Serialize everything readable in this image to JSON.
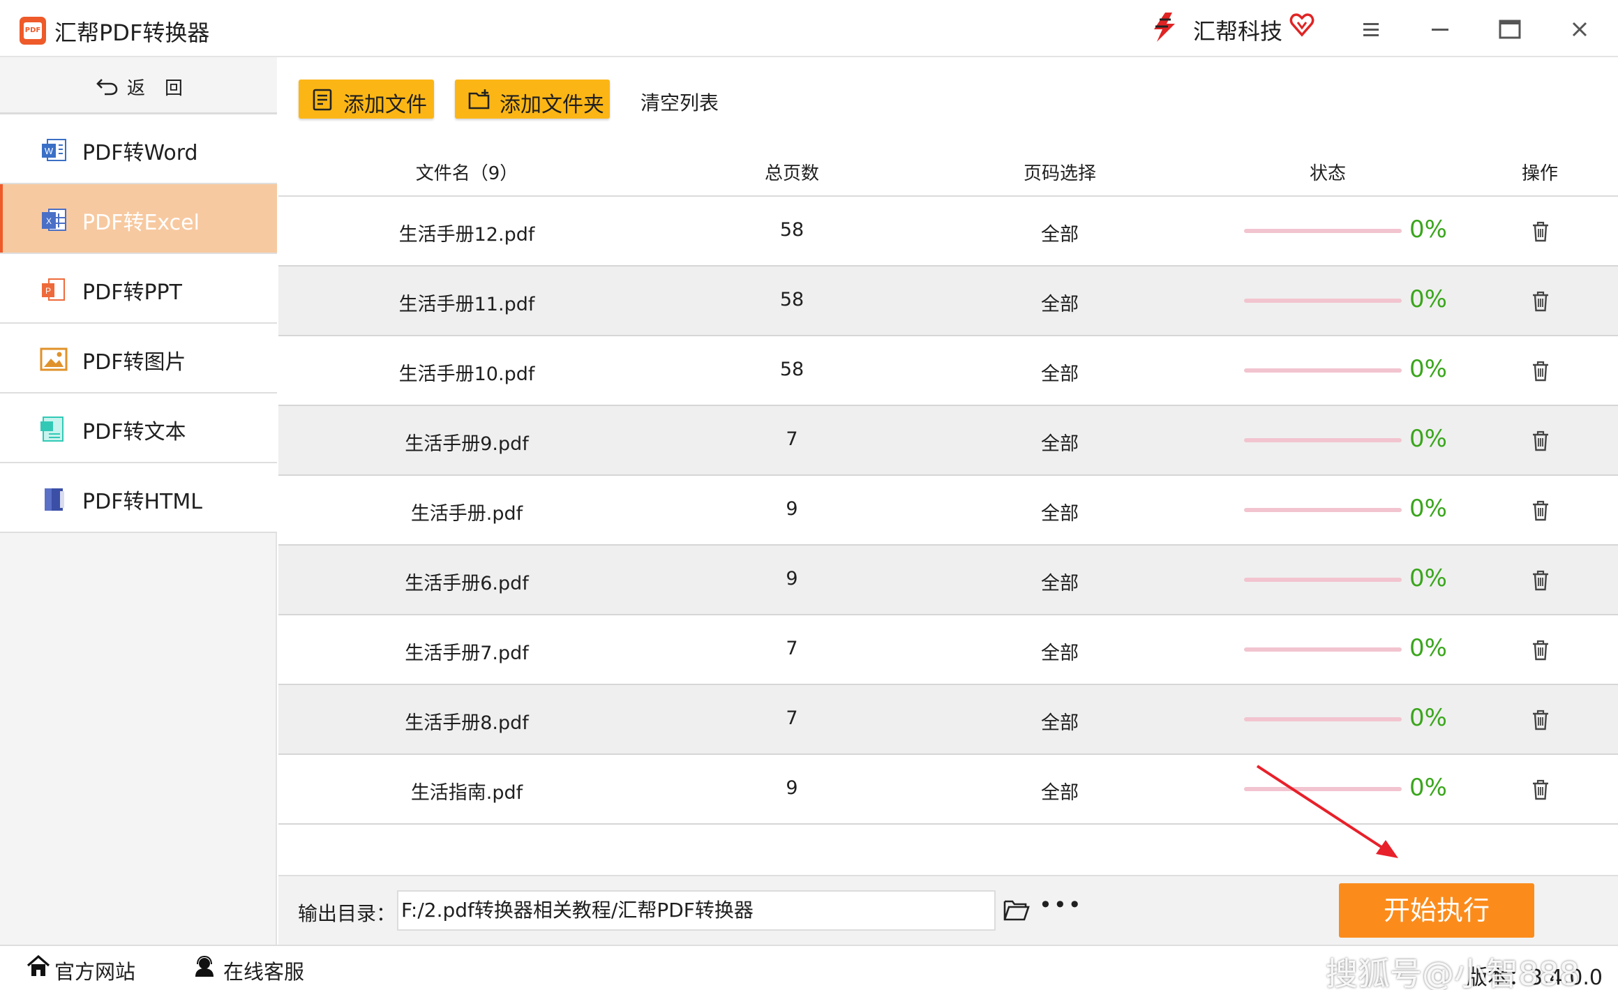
{
  "app": {
    "title": "汇帮PDF转换器",
    "logo_text": "PDF",
    "brand_name": "汇帮科技"
  },
  "sidebar": {
    "back_label": "返回",
    "items": [
      {
        "label": "PDF转Word",
        "icon": "word-icon",
        "active": false
      },
      {
        "label": "PDF转Excel",
        "icon": "excel-icon",
        "active": true
      },
      {
        "label": "PDF转PPT",
        "icon": "ppt-icon",
        "active": false
      },
      {
        "label": "PDF转图片",
        "icon": "image-icon",
        "active": false
      },
      {
        "label": "PDF转文本",
        "icon": "text-icon",
        "active": false
      },
      {
        "label": "PDF转HTML",
        "icon": "html-icon",
        "active": false
      }
    ]
  },
  "toolbar": {
    "add_file_label": "添加文件",
    "add_folder_label": "添加文件夹",
    "clear_label": "清空列表"
  },
  "table": {
    "headers": {
      "filename": "文件名（9）",
      "pages": "总页数",
      "range": "页码选择",
      "status": "状态",
      "action": "操作"
    },
    "rows": [
      {
        "filename": "生活手册12.pdf",
        "pages": "58",
        "range": "全部",
        "progress": 0,
        "percent": "0%"
      },
      {
        "filename": "生活手册11.pdf",
        "pages": "58",
        "range": "全部",
        "progress": 0,
        "percent": "0%"
      },
      {
        "filename": "生活手册10.pdf",
        "pages": "58",
        "range": "全部",
        "progress": 0,
        "percent": "0%"
      },
      {
        "filename": "生活手册9.pdf",
        "pages": "7",
        "range": "全部",
        "progress": 0,
        "percent": "0%"
      },
      {
        "filename": "生活手册.pdf",
        "pages": "9",
        "range": "全部",
        "progress": 0,
        "percent": "0%"
      },
      {
        "filename": "生活手册6.pdf",
        "pages": "9",
        "range": "全部",
        "progress": 0,
        "percent": "0%"
      },
      {
        "filename": "生活手册7.pdf",
        "pages": "7",
        "range": "全部",
        "progress": 0,
        "percent": "0%"
      },
      {
        "filename": "生活手册8.pdf",
        "pages": "7",
        "range": "全部",
        "progress": 0,
        "percent": "0%"
      },
      {
        "filename": "生活指南.pdf",
        "pages": "9",
        "range": "全部",
        "progress": 0,
        "percent": "0%"
      }
    ]
  },
  "output": {
    "label": "输出目录：",
    "path": "F:/2.pdf转换器相关教程/汇帮PDF转换器",
    "more_label": "•••",
    "start_label": "开始执行"
  },
  "statusbar": {
    "website_label": "官方网站",
    "support_label": "在线客服",
    "version_text": "版本：3.4.0.0",
    "watermark": "搜狐号@小智888"
  },
  "colors": {
    "accent": "#ee5a2a",
    "toolbar_button": "#fbb616",
    "start_button": "#fb8c1c",
    "active_nav": "#f7c9a0",
    "percent_text": "#3aa61c",
    "progress_track": "#f2c4cf",
    "annotation_arrow": "#e8202a"
  }
}
